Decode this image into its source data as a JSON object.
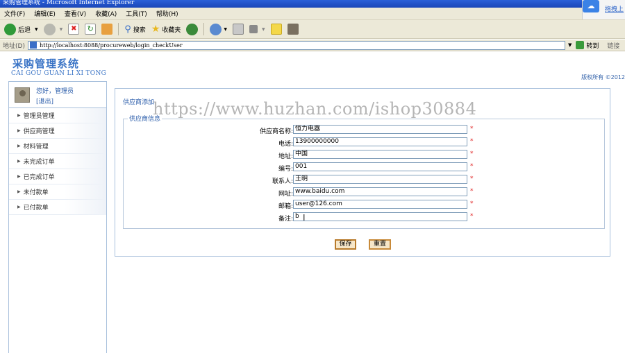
{
  "window": {
    "title": "采购管理系统 - Microsoft Internet Explorer"
  },
  "menu": [
    "文件(F)",
    "编辑(E)",
    "查看(V)",
    "收藏(A)",
    "工具(T)",
    "帮助(H)"
  ],
  "menu_extra": {
    "text": "拖拽上"
  },
  "toolbar": {
    "back": "后退",
    "search": "搜索",
    "favorites": "收藏夹"
  },
  "address": {
    "label": "地址(D)",
    "url": "http://localhost:8088/procureweb/login_checkUser",
    "go": "转到",
    "links": "链接"
  },
  "header": {
    "logo": "采购管理系统",
    "logo_pinyin": "CAI GOU GUAN LI XI TONG",
    "copyright": "版权所有 ©2012"
  },
  "watermark": "https://www.huzhan.com/ishop30884",
  "user": {
    "greeting": "您好，管理员",
    "logout": "[退出]"
  },
  "sidebar": {
    "items": [
      {
        "label": "管理员管理"
      },
      {
        "label": "供应商管理"
      },
      {
        "label": "材料管理"
      },
      {
        "label": "未完成订单"
      },
      {
        "label": "已完成订单"
      },
      {
        "label": "未付款单"
      },
      {
        "label": "已付款单"
      }
    ]
  },
  "form": {
    "title": "供应商添加",
    "legend": "供应商信息",
    "required_mark": "*",
    "fields": [
      {
        "label": "供应商名称:",
        "value": "恒力电器"
      },
      {
        "label": "电话:",
        "value": "13900000000"
      },
      {
        "label": "地址:",
        "value": "中国"
      },
      {
        "label": "编号:",
        "value": "001"
      },
      {
        "label": "联系人:",
        "value": "王明"
      },
      {
        "label": "网址:",
        "value": "www.baidu.com"
      },
      {
        "label": "邮箱:",
        "value": "user@126.com"
      },
      {
        "label": "备注:",
        "value": "b"
      }
    ],
    "save": "保存",
    "reset": "重置"
  },
  "colors": {
    "link": "#2a5caa",
    "border": "#a8c0dc",
    "required": "#e02020"
  }
}
